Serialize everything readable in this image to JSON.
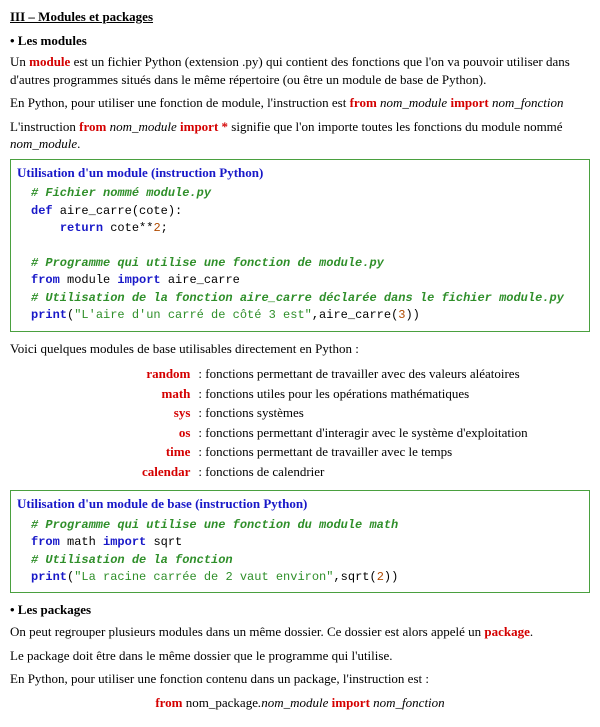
{
  "heading": "III – Modules et packages",
  "section1": {
    "title": "• Les modules",
    "p1_a": "Un ",
    "p1_kw": "module",
    "p1_b": " est un fichier Python (extension .py) qui contient des fonctions que l'on va pouvoir utiliser dans d'autres programmes situés dans le même répertoire (ou être un module de base de Python).",
    "p2_a": "En Python, pour utiliser une fonction de module, l'instruction est ",
    "p2_from": "from",
    "p2_mod": " nom_module ",
    "p2_import": "import",
    "p2_fn": " nom_fonction",
    "p3_a": "L'instruction ",
    "p3_from": "from",
    "p3_mod": " nom_module ",
    "p3_import": "import",
    "p3_star": " *",
    "p3_b": " signifie que l'on importe toutes les fonctions du module nommé ",
    "p3_modend": "nom_module",
    "p3_dot": "."
  },
  "box1": {
    "title": "Utilisation d'un module (instruction Python)",
    "l1": "# Fichier nommé module.py",
    "l2_def": "def",
    "l2_name": " aire_carre(cote):",
    "l3_ret": "return",
    "l3_rest": " cote**",
    "l3_num": "2",
    "l3_semi": ";",
    "l4": "",
    "l5": "# Programme qui utilise une fonction de module.py",
    "l6_from": "from",
    "l6_mod": " module ",
    "l6_import": "import",
    "l6_fn": " aire_carre",
    "l7": "# Utilisation de la fonction aire_carre déclarée dans le fichier module.py",
    "l8_print": "print",
    "l8_open": "(",
    "l8_str": "\"L'aire d'un carré de côté 3 est\"",
    "l8_mid": ",aire_carre(",
    "l8_num": "3",
    "l8_close": "))"
  },
  "mods_intro": "Voici quelques modules de base utilisables directement en Python :",
  "mods": [
    {
      "name": "random",
      "desc": ": fonctions permettant de travailler avec des valeurs aléatoires"
    },
    {
      "name": "math",
      "desc": ": fonctions utiles pour les opérations mathématiques"
    },
    {
      "name": "sys",
      "desc": ": fonctions systèmes"
    },
    {
      "name": "os",
      "desc": ": fonctions permettant d'interagir avec le système d'exploitation"
    },
    {
      "name": "time",
      "desc": ": fonctions permettant de travailler avec le temps"
    },
    {
      "name": "calendar",
      "desc": ": fonctions de calendrier"
    }
  ],
  "box2": {
    "title": "Utilisation d'un module de base (instruction Python)",
    "l1": "# Programme qui utilise une fonction du module math",
    "l2_from": "from",
    "l2_mod": " math ",
    "l2_import": "import",
    "l2_fn": " sqrt",
    "l3": "# Utilisation de la fonction",
    "l4_print": "print",
    "l4_open": "(",
    "l4_str": "\"La racine carrée de 2 vaut environ\"",
    "l4_mid": ",sqrt(",
    "l4_num": "2",
    "l4_close": "))"
  },
  "section2": {
    "title": "• Les packages",
    "p1_a": "On peut regrouper plusieurs modules dans un même dossier. Ce dossier est alors appelé un ",
    "p1_kw": "package",
    "p1_b": ".",
    "p2": "Le package doit être dans le même dossier que le programme qui l'utilise.",
    "p3": "En Python, pour utiliser une fonction contenu dans un package, l'instruction est :",
    "syntax_from": "from",
    "syntax_pkg": " nom_package",
    "syntax_dot": ".",
    "syntax_mod": "nom_module ",
    "syntax_import": "import",
    "syntax_fn": " nom_fonction"
  }
}
